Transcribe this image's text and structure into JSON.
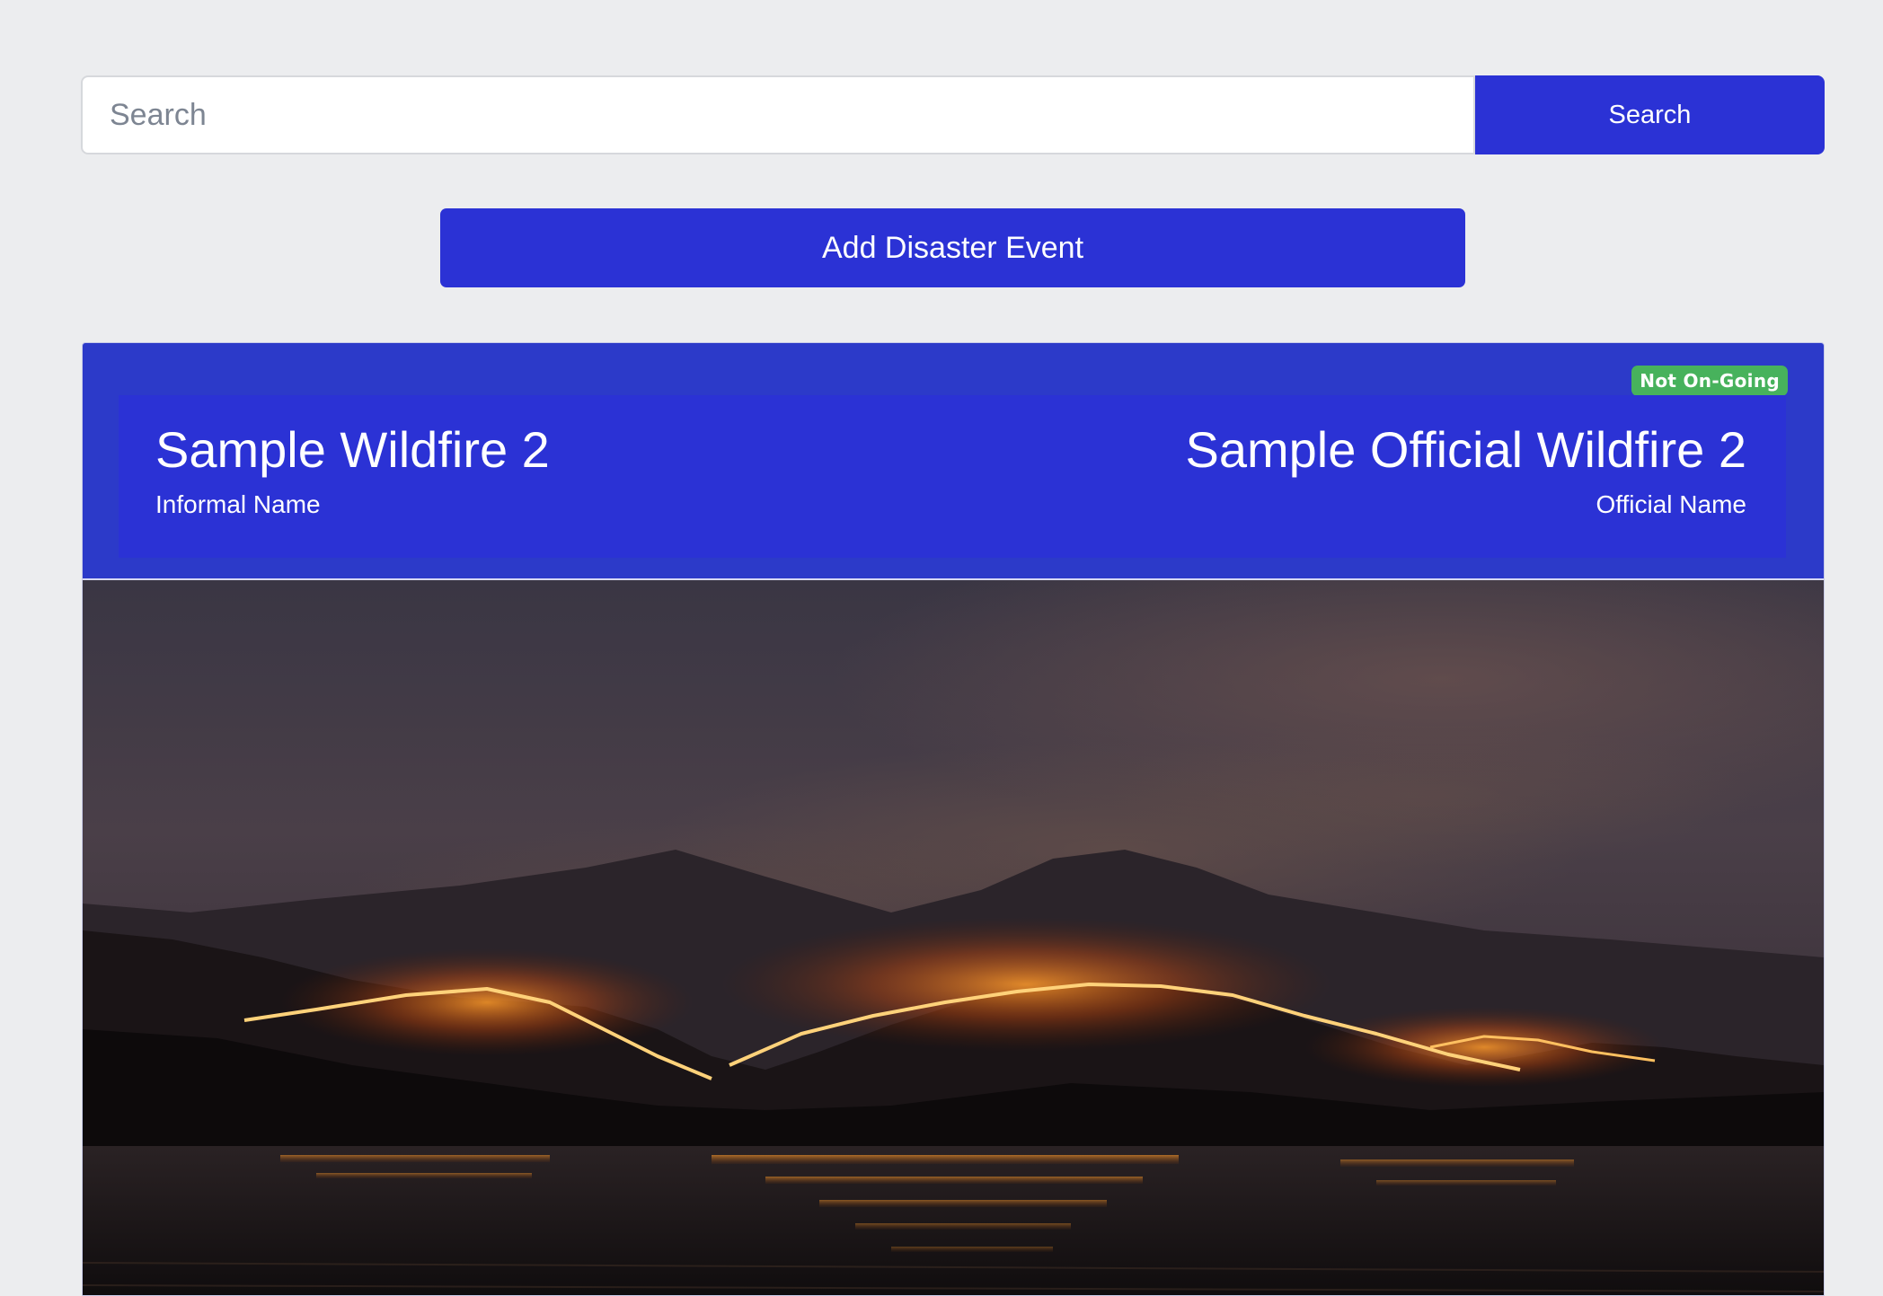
{
  "search": {
    "placeholder": "Search",
    "button_label": "Search"
  },
  "actions": {
    "add_label": "Add Disaster Event"
  },
  "event": {
    "status": "Not On-Going",
    "informal_name": "Sample Wildfire 2",
    "informal_caption": "Informal Name",
    "official_name": "Sample Official Wildfire 2",
    "official_caption": "Official Name",
    "image_icon": "wildfire-photo"
  },
  "colors": {
    "primary": "#2b32d5",
    "card": "#2c3ac9",
    "badge": "#47b25c",
    "background": "#ecedef"
  }
}
